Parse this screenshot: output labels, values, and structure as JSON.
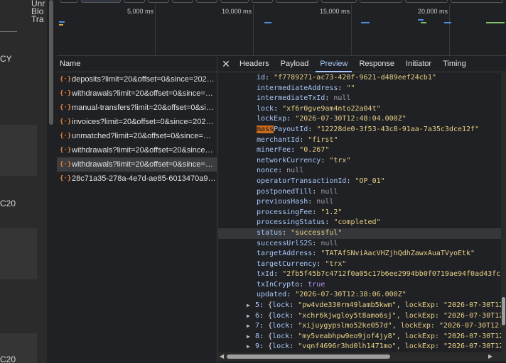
{
  "app": {
    "header_lines": [
      "Unr",
      "Blo",
      "Tra"
    ],
    "labels": [
      "CY",
      "C20",
      "C20"
    ]
  },
  "overview": {
    "ticks": [
      "5,000 ms",
      "10,000 ms",
      "15,000 ms",
      "20,000 ms"
    ]
  },
  "network": {
    "header": "Name",
    "requests": [
      "deposits?limit=20&offset=0&since=202…",
      "withdrawals?limit=20&offset=0&since=…",
      "manual-transfers?limit=20&offset=0&si…",
      "invoices?limit=20&offset=0&since=202…",
      "unmatched?limit=20&offset=0&since=…",
      "withdrawals?limit=20&offset=20&since…",
      "withdrawals?limit=20&offset=0&since=…",
      "28c71a35-278a-4e7d-ae85-6013470a91…"
    ],
    "selected_index": 6
  },
  "detail": {
    "tabs": [
      "Headers",
      "Payload",
      "Preview",
      "Response",
      "Initiator",
      "Timing"
    ],
    "active_tab": "Preview",
    "fields": [
      {
        "key": "id",
        "value": "\"f7789271-ac73-420f-9621-d489eef24cb1\"",
        "kind": "str"
      },
      {
        "key": "intermediateAddress",
        "value": "\"\"",
        "kind": "str"
      },
      {
        "key": "intermediateTxId",
        "value": "null",
        "kind": "null"
      },
      {
        "key": "lock",
        "value": "\"xf6r0gve9am4nto22a04t\"",
        "kind": "str"
      },
      {
        "key": "lockExp",
        "value": "\"2026-07-30T12:48:04.000Z\"",
        "kind": "str"
      },
      {
        "key": "massPayoutId",
        "value": "\"12228de0-3f53-43c8-91aa-7a35c3dce12f\"",
        "kind": "str",
        "highlight": "mass"
      },
      {
        "key": "merchantId",
        "value": "\"first\"",
        "kind": "str"
      },
      {
        "key": "minerFee",
        "value": "\"0.267\"",
        "kind": "str"
      },
      {
        "key": "networkCurrency",
        "value": "\"trx\"",
        "kind": "str"
      },
      {
        "key": "nonce",
        "value": "null",
        "kind": "null"
      },
      {
        "key": "operatorTransactionId",
        "value": "\"OP_01\"",
        "kind": "str"
      },
      {
        "key": "postponedTill",
        "value": "null",
        "kind": "null"
      },
      {
        "key": "previousHash",
        "value": "null",
        "kind": "null"
      },
      {
        "key": "processingFee",
        "value": "\"1.2\"",
        "kind": "str"
      },
      {
        "key": "processingStatus",
        "value": "\"completed\"",
        "kind": "str"
      },
      {
        "key": "status",
        "value": "\"successful\"",
        "kind": "str",
        "selected": true
      },
      {
        "key": "successUrlS2S",
        "value": "null",
        "kind": "null"
      },
      {
        "key": "targetAddress",
        "value": "\"TATAfSNviAacVHZjhQdhZawxAuaTVyoEtk\"",
        "kind": "str"
      },
      {
        "key": "targetCurrency",
        "value": "\"trx\"",
        "kind": "str"
      },
      {
        "key": "txId",
        "value": "\"2fb5f45b7c4712f0a05c17b6ee2994bb0f0719ae94f0ad43fc",
        "kind": "str"
      },
      {
        "key": "txInCrypto",
        "value": "true",
        "kind": "bool"
      },
      {
        "key": "updated",
        "value": "\"2026-07-30T12:38:06.000Z\"",
        "kind": "str"
      }
    ],
    "collapsed": [
      {
        "index": "5",
        "lock": "\"pw4vde330rm49lamb5kwm\"",
        "tail": ", lockExp: \"2026-07-30T12:"
      },
      {
        "index": "6",
        "lock": "\"xchr6kjwgloy5t8amo6sj\"",
        "tail": ", lockExp: \"2026-07-30T12:"
      },
      {
        "index": "7",
        "lock": "\"xijuygypslmo52ke057d\"",
        "tail": ", lockExp: \"2026-07-30T12:4"
      },
      {
        "index": "8",
        "lock": "\"my5veabhpw9eo9jof4jy8\"",
        "tail": ", lockExp: \"2026-07-30T12:"
      },
      {
        "index": "9",
        "lock": "\"vqnf4696r3hd0lh1471mo\"",
        "tail": ", lockExp: \"2026-07-30T12:"
      }
    ]
  },
  "colors": {
    "accent": "#a8c7fa",
    "string": "#e8d187",
    "xhr_icon": "#e8833a",
    "search_highlight": "#c96a1c"
  }
}
